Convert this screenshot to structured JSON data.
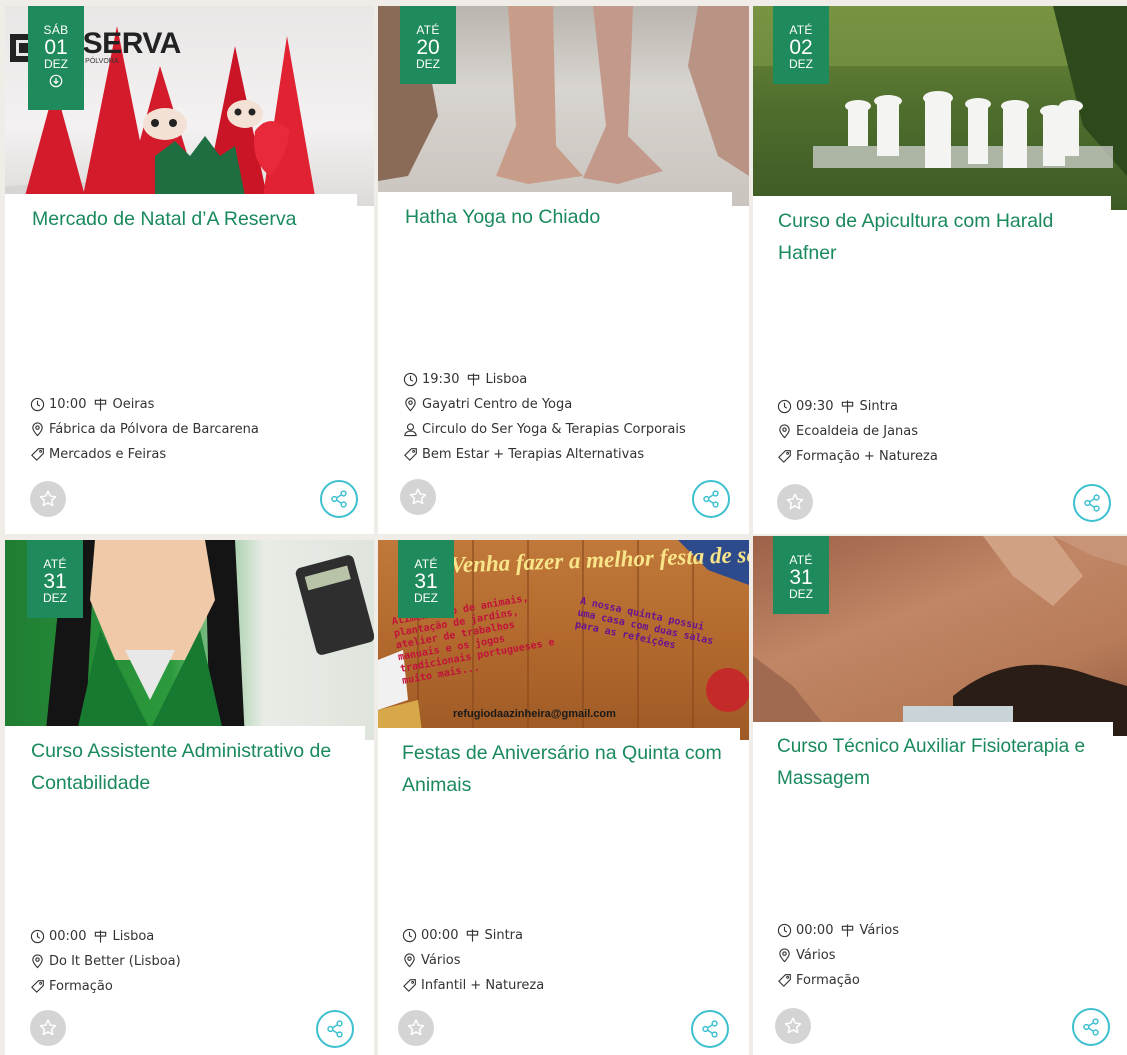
{
  "events": [
    {
      "date_weekday": "SÁB",
      "date_day": "01",
      "date_month": "DEZ",
      "title": "Mercado de Natal d’A Reserva",
      "time": "10:00",
      "city": "Oeiras",
      "venue": "Fábrica da Pólvora de Barcarena",
      "category": "Mercados e Feiras",
      "image_logo": "RESERVA",
      "image_logo_sub": "FÁBRICA DA PÓLVORA"
    },
    {
      "date_weekday": "ATÉ",
      "date_day": "20",
      "date_month": "DEZ",
      "title": "Hatha Yoga no Chiado",
      "time": "19:30",
      "city": "Lisboa",
      "venue": "Gayatri Centro de Yoga",
      "organizer": "Circulo do Ser Yoga & Terapias Corporais",
      "category": "Bem Estar + Terapias Alternativas"
    },
    {
      "date_weekday": "ATÉ",
      "date_day": "02",
      "date_month": "DEZ",
      "title": "Curso de Apicultura com Harald Hafner",
      "time": "09:30",
      "city": "Sintra",
      "venue": "Ecoaldeia de Janas",
      "category": "Formação + Natureza"
    },
    {
      "date_weekday": "ATÉ",
      "date_day": "31",
      "date_month": "DEZ",
      "title": "Curso Assistente Administrativo de Contabilidade",
      "time": "00:00",
      "city": "Lisboa",
      "venue": "Do It Better (Lisboa)",
      "category": "Formação"
    },
    {
      "date_weekday": "ATÉ",
      "date_day": "31",
      "date_month": "DEZ",
      "title": "Festas de Aniversário na Quinta com Animais",
      "time": "00:00",
      "city": "Sintra",
      "venue": "Vários",
      "category": "Infantil + Natureza",
      "image_text_top": "Venha fazer a melhor festa de sempre...",
      "image_text_left": "Alimentação de animais, plantação de jardins, atelier de trabalhos manuais e os jogos tradicionais portugueses e muito mais...",
      "image_text_right": "A nossa quinta possui uma casa com duas salas para as refeições",
      "image_email": "refugiodaazinheira@gmail.com"
    },
    {
      "date_weekday": "ATÉ",
      "date_day": "31",
      "date_month": "DEZ",
      "title": "Curso Técnico Auxiliar Fisioterapia e Massagem",
      "time": "00:00",
      "city": "Vários",
      "venue": "Vários",
      "category": "Formação"
    }
  ],
  "colors": {
    "accent": "#1f8a5b",
    "title": "#1a8a5c",
    "share_ring": "#3ec0cf",
    "fav_bg": "#d4d4d4"
  },
  "icons": {
    "time": "clock-icon",
    "city": "signpost-icon",
    "venue": "map-pin-icon",
    "organizer": "user-icon",
    "category": "tag-icon",
    "favorite": "star-icon",
    "share": "share-icon",
    "download": "download-circle-icon"
  }
}
